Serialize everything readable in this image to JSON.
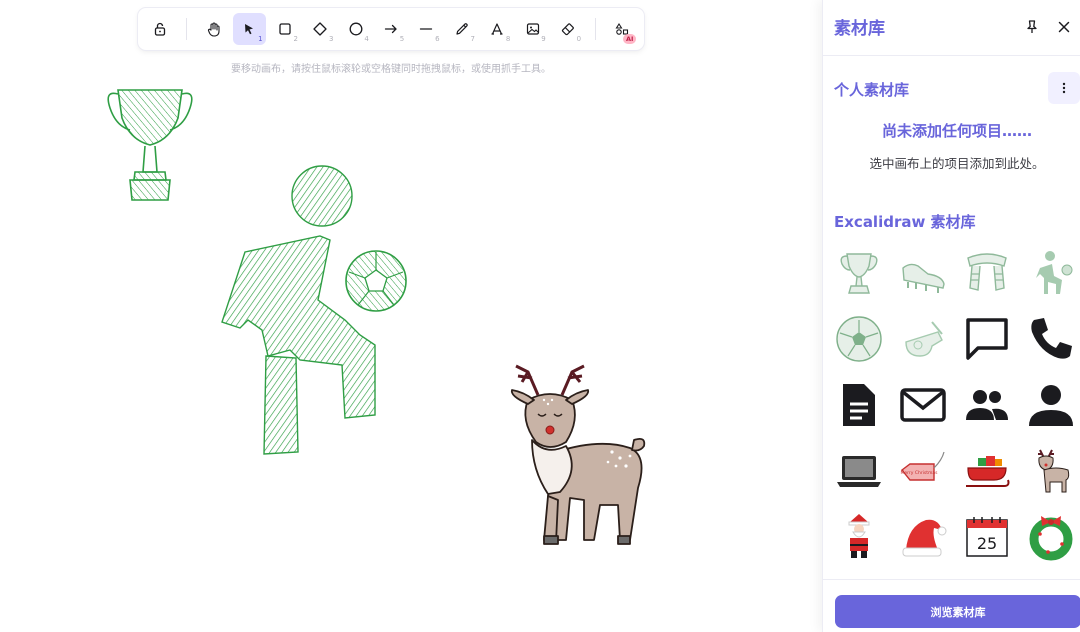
{
  "toolbar": {
    "tools": [
      {
        "name": "lock",
        "key": ""
      },
      {
        "name": "hand",
        "key": ""
      },
      {
        "name": "selection",
        "key": "1"
      },
      {
        "name": "rectangle",
        "key": "2"
      },
      {
        "name": "diamond",
        "key": "3"
      },
      {
        "name": "ellipse",
        "key": "4"
      },
      {
        "name": "arrow",
        "key": "5"
      },
      {
        "name": "line",
        "key": "6"
      },
      {
        "name": "draw",
        "key": "7"
      },
      {
        "name": "text",
        "key": "8"
      },
      {
        "name": "image",
        "key": "9"
      },
      {
        "name": "eraser",
        "key": "0"
      },
      {
        "name": "more-tools",
        "key": ""
      }
    ],
    "active_tool": "selection",
    "ai_badge": "AI"
  },
  "canvas": {
    "hint": "要移动画布，请按住鼠标滚轮或空格键同时拖拽鼠标，或使用抓手工具。",
    "accent_green": "#2f9e44",
    "deer_body": "#c8b3a6"
  },
  "sidebar": {
    "title": "素材库",
    "personal_title": "个人素材库",
    "empty_title": "尚未添加任何项目……",
    "empty_subtitle": "选中画布上的项目添加到此处。",
    "excalidraw_title": "Excalidraw 素材库",
    "browse_button": "浏览素材库",
    "accent": "#6965db",
    "library_items": [
      "trophy-icon",
      "soccer-shoe-icon",
      "scarf-icon",
      "soccer-player-icon",
      "soccer-ball-icon",
      "whistle-icon",
      "chat-bubble-icon",
      "phone-icon",
      "document-icon",
      "mail-icon",
      "group-icon",
      "user-icon",
      "laptop-icon",
      "gift-tag-icon",
      "sleigh-icon",
      "reindeer-icon",
      "santa-icon",
      "santa-hat-icon",
      "calendar-icon",
      "wreath-icon"
    ],
    "calendar_day": "25",
    "gift_tag_text": "Merry Christmas"
  }
}
